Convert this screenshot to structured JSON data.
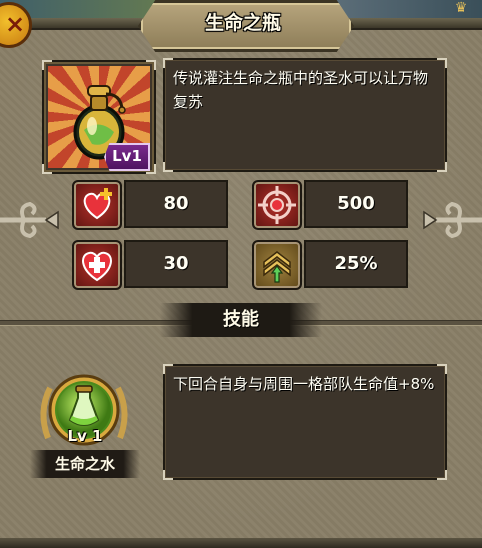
{
  "title": "生命之瓶",
  "close_label": "×",
  "item": {
    "level": "Lv1",
    "description": "传说灌注生命之瓶中的圣水可以让万物复苏"
  },
  "stats": [
    {
      "icon": "heart-plus-icon",
      "value": "80"
    },
    {
      "icon": "crosshair-target-icon",
      "value": "500"
    },
    {
      "icon": "heart-cross-icon",
      "value": "30"
    },
    {
      "icon": "rank-chevrons-icon",
      "value": "25%"
    }
  ],
  "skill": {
    "section_title": "技能",
    "level": "Lv 1",
    "name": "生命之水",
    "description": "下回合自身与周围一格部队生命值+8%"
  },
  "colors": {
    "panel": "#8a8068",
    "dark_box": "#3c342a",
    "level_badge": "#6a2380",
    "accent_gold": "#f2bf2c"
  }
}
